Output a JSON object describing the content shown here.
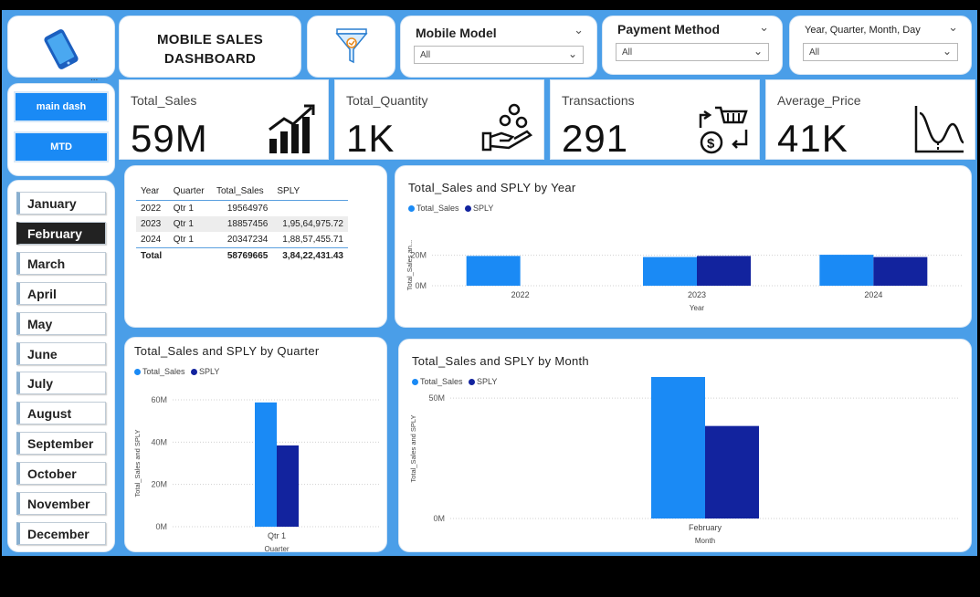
{
  "header": {
    "title_line1": "MOBILE SALES",
    "title_line2": "DASHBOARD",
    "logo_icon": "mobile-phone-icon",
    "filter_icon": "filter-funnel-icon",
    "more_options": "..."
  },
  "slicers": [
    {
      "label": "Mobile Model",
      "value": "All"
    },
    {
      "label": "Payment Method",
      "value": "All"
    },
    {
      "label": "Year, Quarter, Month, Day",
      "value": "All"
    }
  ],
  "nav": {
    "main_dash_label": "main dash",
    "mtd_label": "MTD"
  },
  "months": {
    "items": [
      "January",
      "February",
      "March",
      "April",
      "May",
      "June",
      "July",
      "August",
      "September",
      "October",
      "November",
      "December"
    ],
    "selected": "February"
  },
  "kpis": [
    {
      "label": "Total_Sales",
      "value": "59M",
      "icon": "growth-chart-icon"
    },
    {
      "label": "Total_Quantity",
      "value": "1K",
      "icon": "hand-coins-icon"
    },
    {
      "label": "Transactions",
      "value": "291",
      "icon": "cart-exchange-icon"
    },
    {
      "label": "Average_Price",
      "value": "41K",
      "icon": "bell-curve-icon"
    }
  ],
  "table": {
    "headers": [
      "Year",
      "Quarter",
      "Total_Sales",
      "SPLY"
    ],
    "rows": [
      [
        "2022",
        "Qtr 1",
        "19564976",
        ""
      ],
      [
        "2023",
        "Qtr 1",
        "18857456",
        "1,95,64,975.72"
      ],
      [
        "2024",
        "Qtr 1",
        "20347234",
        "1,88,57,455.71"
      ]
    ],
    "total": [
      "Total",
      "",
      "58769665",
      "3,84,22,431.43"
    ]
  },
  "colors": {
    "total_sales": "#1a8af5",
    "sply": "#12239e",
    "canvas": "#4a9ee8"
  },
  "chart_data": [
    {
      "type": "bar",
      "title": "Total_Sales and SPLY by Year",
      "xlabel": "Year",
      "ylabel": "Total_Sales an...",
      "categories": [
        "2022",
        "2023",
        "2024"
      ],
      "series": [
        {
          "name": "Total_Sales",
          "values": [
            19564976,
            18857456,
            20347234
          ]
        },
        {
          "name": "SPLY",
          "values": [
            null,
            19564975.72,
            18857455.71
          ]
        }
      ],
      "yticks": [
        "0M",
        "20M"
      ],
      "ylim": [
        0,
        27000000
      ],
      "grid": true,
      "legend": "top-left"
    },
    {
      "type": "bar",
      "title": "Total_Sales and SPLY by Quarter",
      "xlabel": "Quarter",
      "ylabel": "Total_Sales and SPLY",
      "categories": [
        "Qtr 1"
      ],
      "series": [
        {
          "name": "Total_Sales",
          "values": [
            58769665
          ]
        },
        {
          "name": "SPLY",
          "values": [
            38422431.43
          ]
        }
      ],
      "yticks": [
        "0M",
        "20M",
        "40M",
        "60M"
      ],
      "ylim": [
        0,
        60000000
      ],
      "grid": true,
      "legend": "top-left"
    },
    {
      "type": "bar",
      "title": "Total_Sales and SPLY by Month",
      "xlabel": "Month",
      "ylabel": "Total_Sales and SPLY",
      "categories": [
        "February"
      ],
      "series": [
        {
          "name": "Total_Sales",
          "values": [
            58769665
          ]
        },
        {
          "name": "SPLY",
          "values": [
            38422431.43
          ]
        }
      ],
      "yticks": [
        "0M",
        "50M"
      ],
      "ylim": [
        0,
        58000000
      ],
      "grid": true,
      "legend": "top-left"
    }
  ]
}
